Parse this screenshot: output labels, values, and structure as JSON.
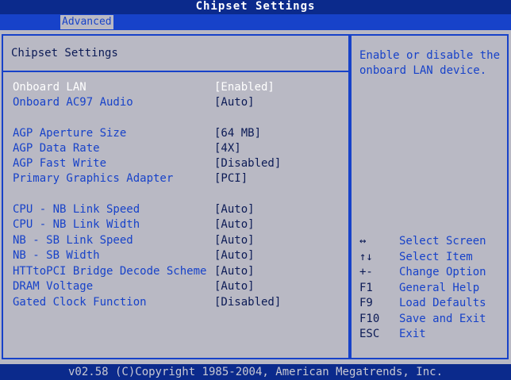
{
  "title": "Chipset Settings",
  "menu": {
    "active_tab": "Advanced"
  },
  "main": {
    "section_title": "Chipset Settings",
    "settings": [
      {
        "label": "Onboard LAN",
        "value": "[Enabled]",
        "selected": true
      },
      {
        "label": "Onboard AC97 Audio",
        "value": "[Auto]"
      },
      {
        "label": "AGP Aperture Size",
        "value": "[64 MB]"
      },
      {
        "label": "AGP Data Rate",
        "value": "[4X]"
      },
      {
        "label": "AGP Fast Write",
        "value": "[Disabled]"
      },
      {
        "label": "Primary Graphics Adapter",
        "value": "[PCI]"
      },
      {
        "label": "CPU - NB Link Speed",
        "value": "[Auto]"
      },
      {
        "label": "CPU - NB Link Width",
        "value": "[Auto]"
      },
      {
        "label": "NB - SB Link Speed",
        "value": "[Auto]"
      },
      {
        "label": "NB - SB Width",
        "value": "[Auto]"
      },
      {
        "label": "HTTtoPCI Bridge Decode Scheme",
        "value": "[Auto]"
      },
      {
        "label": "DRAM Voltage",
        "value": "[Auto]"
      },
      {
        "label": "Gated Clock Function",
        "value": "[Disabled]"
      }
    ]
  },
  "help": {
    "description": "Enable or disable the onboard LAN device.",
    "keys": [
      {
        "key": "↔",
        "desc": "Select Screen"
      },
      {
        "key": "↑↓",
        "desc": "Select Item"
      },
      {
        "key": "+-",
        "desc": "Change Option"
      },
      {
        "key": "F1",
        "desc": "General Help"
      },
      {
        "key": "F9",
        "desc": "Load Defaults"
      },
      {
        "key": "F10",
        "desc": "Save and Exit"
      },
      {
        "key": "ESC",
        "desc": "Exit"
      }
    ]
  },
  "footer": "v02.58 (C)Copyright 1985-2004, American Megatrends, Inc.",
  "colors": {
    "background_blue": "#0b2a8c",
    "menu_blue": "#1742c9",
    "panel_gray": "#b9b9c4",
    "highlight_white": "#ffffff"
  }
}
